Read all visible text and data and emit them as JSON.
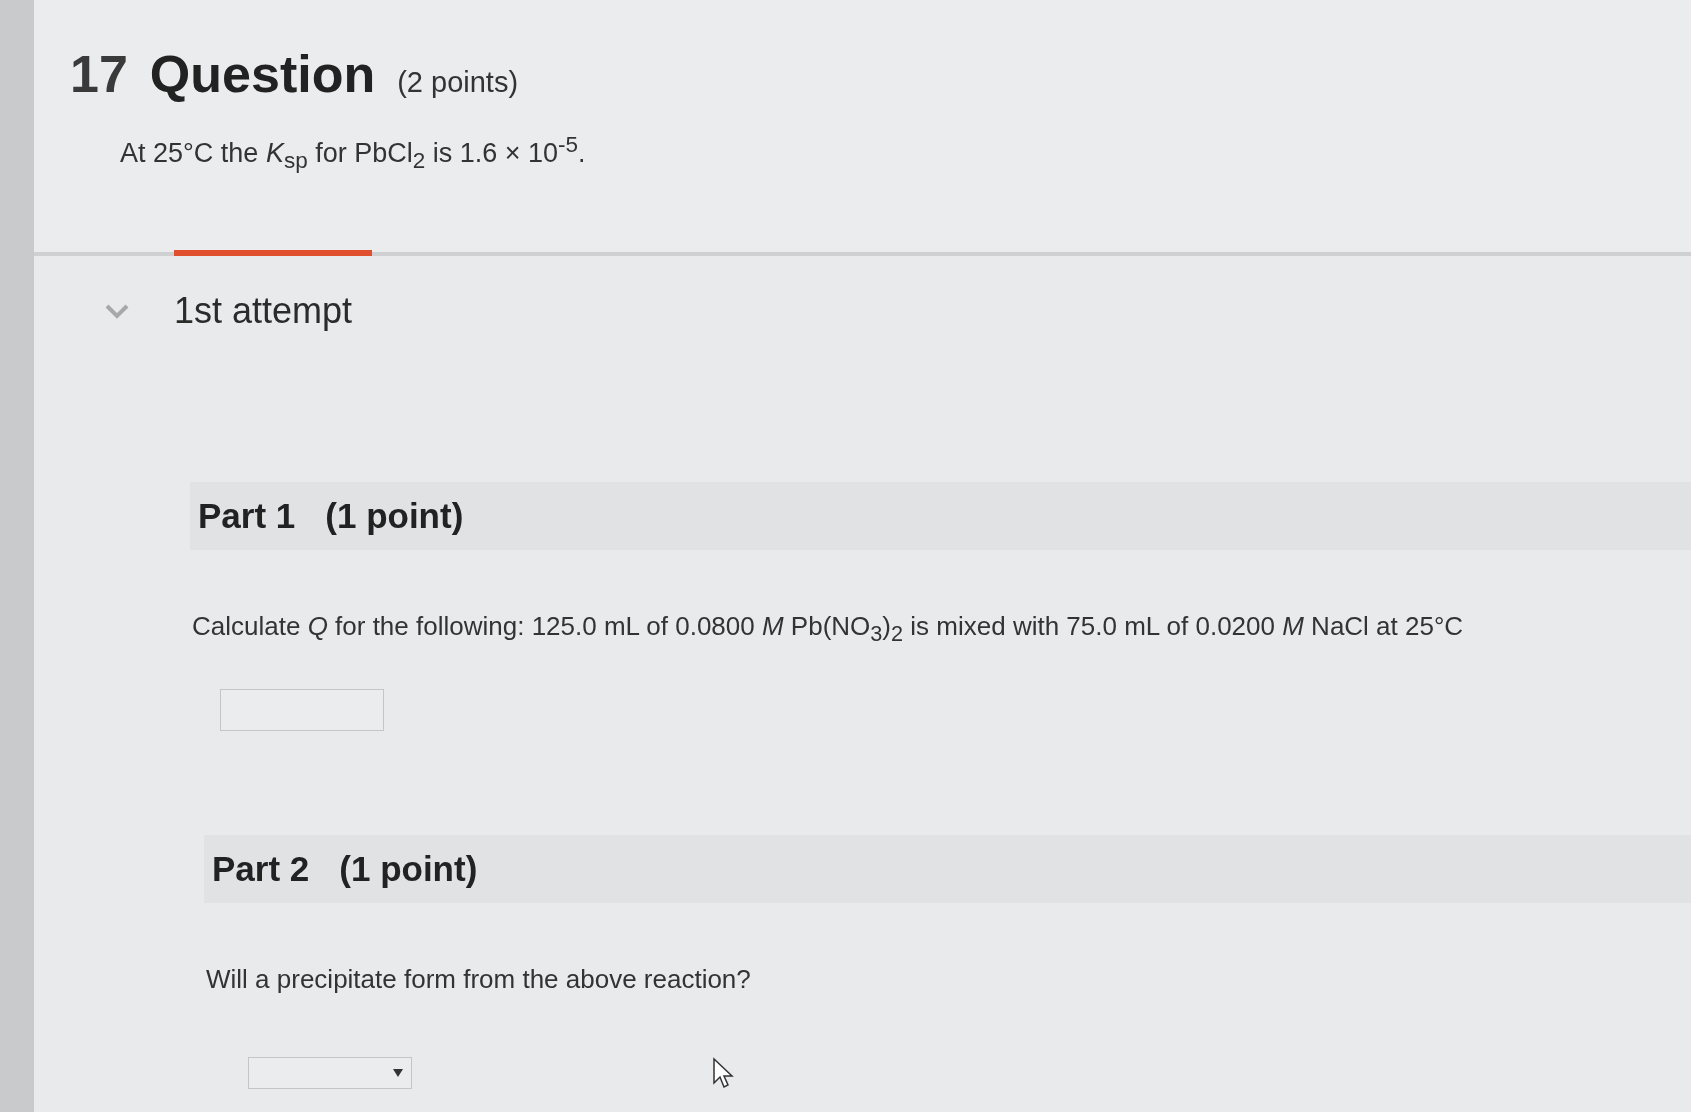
{
  "question": {
    "number": "17",
    "title": "Question",
    "points": "(2 points)",
    "statement": "At 25°C the *K*$_{sp}$ for PbCl$_{2}$ is 1.6 × 10$^{-5}$."
  },
  "attempt": {
    "label": "1st attempt",
    "expanded": true
  },
  "parts": [
    {
      "kind": "numeric",
      "title": "Part 1",
      "points": "(1 point)",
      "prompt": "Calculate *Q* for the following: 125.0 mL of 0.0800 *M* Pb(NO$_{3}$)$_{2}$ is mixed with 75.0 mL of 0.0200 *M* NaCl at 25°C"
    },
    {
      "kind": "dropdown",
      "title": "Part 2",
      "points": "(1 point)",
      "prompt": "Will a precipitate form from the above reaction?"
    }
  ]
}
